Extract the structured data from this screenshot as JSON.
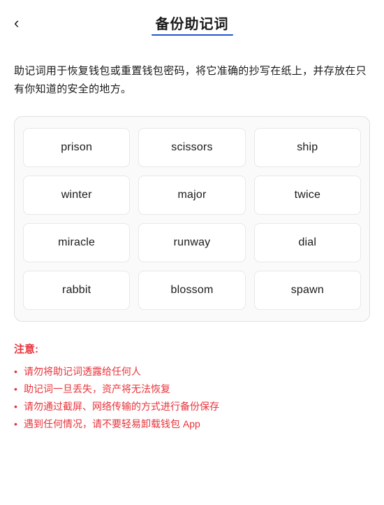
{
  "header": {
    "back_label": "‹",
    "title": "备份助记词"
  },
  "description": "助记词用于恢复钱包或重置钱包密码，将它准确的抄写在纸上，并存放在只有你知道的安全的地方。",
  "mnemonic": {
    "words": [
      "prison",
      "scissors",
      "ship",
      "winter",
      "major",
      "twice",
      "miracle",
      "runway",
      "dial",
      "rabbit",
      "blossom",
      "spawn"
    ]
  },
  "notes": {
    "title": "注意:",
    "items": [
      "请勿将助记词透露给任何人",
      "助记词一旦丢失，资产将无法恢复",
      "请勿通过截屏、网络传输的方式进行备份保存",
      "遇到任何情况，请不要轻易卸载钱包 App"
    ]
  }
}
